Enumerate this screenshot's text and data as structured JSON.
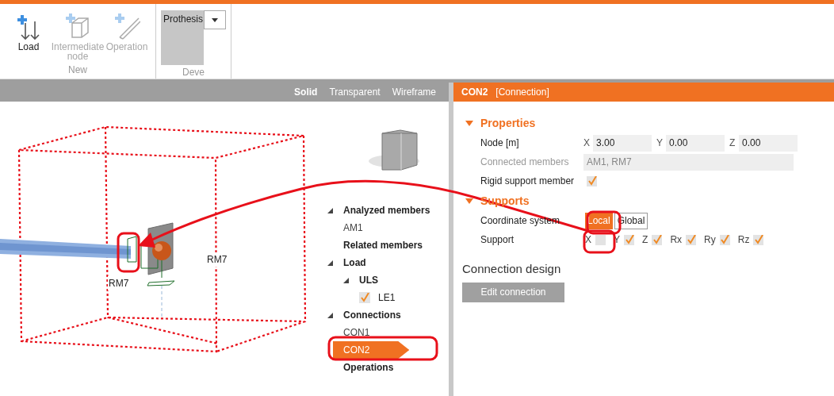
{
  "ribbon": {
    "groups": [
      {
        "label": "New",
        "buttons": [
          {
            "label": "Load",
            "kind": "load",
            "disabled": false
          },
          {
            "label": "Intermediate node",
            "kind": "node",
            "disabled": true
          },
          {
            "label": "Operation",
            "kind": "operation",
            "disabled": true
          }
        ]
      },
      {
        "label": "Deve",
        "dropdown": {
          "value": "Prothesis"
        }
      }
    ]
  },
  "viewport": {
    "view_modes": [
      {
        "label": "Solid",
        "selected": true
      },
      {
        "label": "Transparent",
        "selected": false
      },
      {
        "label": "Wireframe",
        "selected": false
      }
    ],
    "member_labels": [
      "RM7",
      "RM7"
    ]
  },
  "tree": [
    {
      "label": "Analyzed members",
      "kind": "group",
      "selected": false,
      "expanded": true,
      "children": [
        {
          "label": "AM1",
          "kind": "item",
          "selected": false
        }
      ]
    },
    {
      "label": "Related members",
      "kind": "group",
      "selected": false
    },
    {
      "label": "Load",
      "kind": "group",
      "selected": false,
      "expanded": true,
      "children": [
        {
          "label": "ULS",
          "kind": "group",
          "selected": false,
          "expanded": true,
          "children": [
            {
              "label": "LE1",
              "kind": "check",
              "checked": true,
              "selected": false
            }
          ]
        }
      ]
    },
    {
      "label": "Connections",
      "kind": "group",
      "selected": false,
      "expanded": true,
      "children": [
        {
          "label": "CON1",
          "kind": "item",
          "selected": false
        },
        {
          "label": "CON2",
          "kind": "item",
          "selected": true
        }
      ]
    },
    {
      "label": "Operations",
      "kind": "group",
      "selected": false
    }
  ],
  "panel": {
    "title": "CON2",
    "subtitle": "[Connection]",
    "sections": [
      {
        "title": "Properties",
        "expanded": true,
        "rows": [
          {
            "kind": "coords",
            "label": "Node [m]",
            "fields": [
              {
                "axis": "X",
                "value": "3.00"
              },
              {
                "axis": "Y",
                "value": "0.00"
              },
              {
                "axis": "Z",
                "value": "0.00"
              }
            ]
          },
          {
            "kind": "text",
            "label": "Connected members",
            "value": "AM1, RM7",
            "disabled": true
          },
          {
            "kind": "check",
            "label": "Rigid support member",
            "checked": true
          }
        ]
      },
      {
        "title": "Supports",
        "expanded": true,
        "rows": [
          {
            "kind": "toggle",
            "label": "Coordinate system",
            "options": [
              {
                "label": "Local",
                "selected": true
              },
              {
                "label": "Global",
                "selected": false
              }
            ]
          },
          {
            "kind": "checks",
            "label": "Support",
            "items": [
              {
                "label": "X",
                "checked": false
              },
              {
                "label": "Y",
                "checked": true
              },
              {
                "label": "Z",
                "checked": true
              },
              {
                "label": "Rx",
                "checked": true
              },
              {
                "label": "Ry",
                "checked": true
              },
              {
                "label": "Rz",
                "checked": true
              }
            ]
          }
        ]
      }
    ],
    "design": {
      "title": "Connection design",
      "button": "Edit connection"
    }
  }
}
